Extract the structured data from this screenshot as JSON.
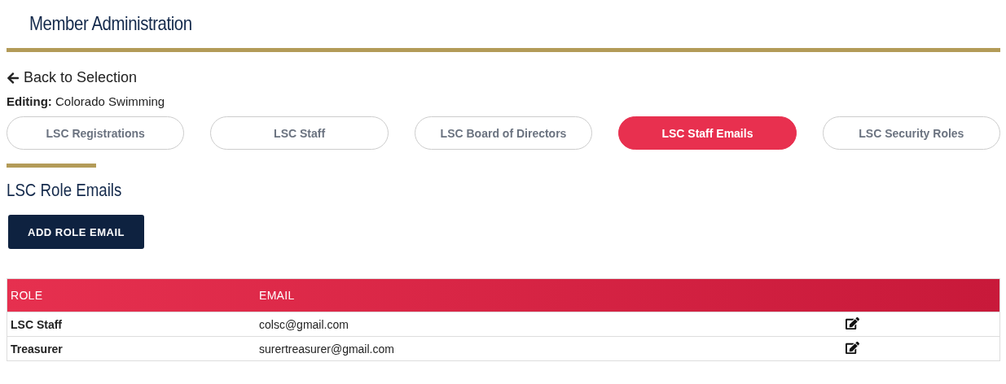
{
  "page_title": "Member Administration",
  "back_link": {
    "label": "Back to Selection"
  },
  "editing": {
    "label": "Editing:",
    "value": "Colorado Swimming"
  },
  "tabs": [
    {
      "label": "LSC Registrations",
      "selected": false
    },
    {
      "label": "LSC Staff",
      "selected": false
    },
    {
      "label": "LSC Board of Directors",
      "selected": false
    },
    {
      "label": "LSC Staff Emails",
      "selected": true
    },
    {
      "label": "LSC Security Roles",
      "selected": false
    }
  ],
  "section_title": "LSC Role Emails",
  "add_button": "ADD ROLE EMAIL",
  "table": {
    "columns": [
      "ROLE",
      "EMAIL"
    ],
    "rows": [
      {
        "role": "LSC Staff",
        "email": "colsc@gmail.com"
      },
      {
        "role": "Treasurer",
        "email": "surertreasurer@gmail.com"
      }
    ]
  }
}
